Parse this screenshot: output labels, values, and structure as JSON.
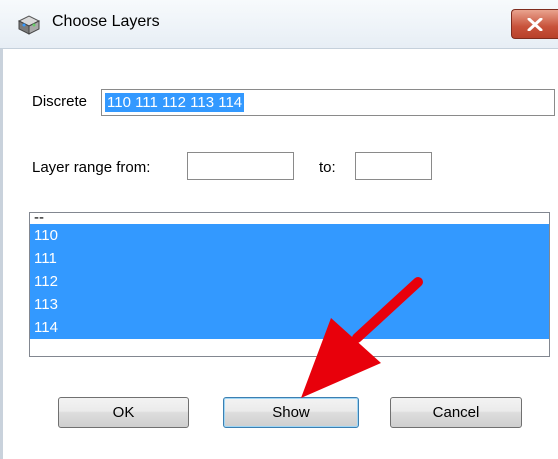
{
  "window": {
    "title": "Choose Layers",
    "icon": "app-window-icon",
    "close_icon": "close-icon"
  },
  "discrete": {
    "label": "Discrete",
    "value": "110 111 112 113 114"
  },
  "range": {
    "from_label": "Layer range from:",
    "from_value": "",
    "to_label": "to:",
    "to_value": ""
  },
  "list": {
    "items": [
      {
        "label": "--",
        "selected": false
      },
      {
        "label": "110",
        "selected": true
      },
      {
        "label": "111",
        "selected": true
      },
      {
        "label": "112",
        "selected": true
      },
      {
        "label": "113",
        "selected": true
      },
      {
        "label": "114",
        "selected": true
      }
    ]
  },
  "buttons": {
    "ok": "OK",
    "show": "Show",
    "cancel": "Cancel"
  },
  "colors": {
    "selection": "#3399ff",
    "annotation_arrow": "#e8000b"
  }
}
